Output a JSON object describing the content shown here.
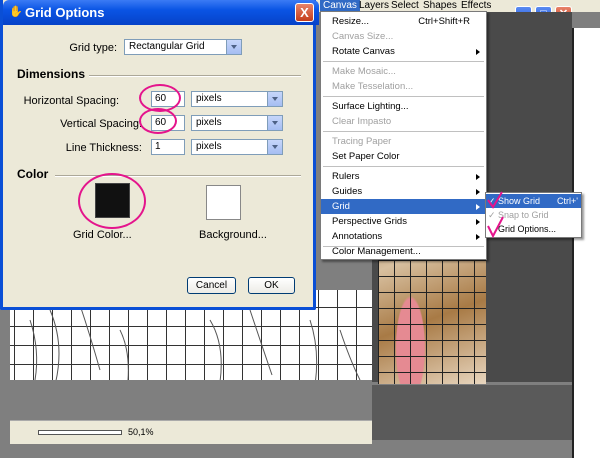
{
  "dialog": {
    "title": "Grid Options",
    "grid_type_label": "Grid type:",
    "grid_type_value": "Rectangular Grid",
    "dimensions_header": "Dimensions",
    "horizontal_spacing_label": "Horizontal Spacing:",
    "horizontal_spacing_value": "60",
    "horizontal_unit": "pixels",
    "vertical_spacing_label": "Vertical Spacing:",
    "vertical_spacing_value": "60",
    "vertical_unit": "pixels",
    "line_thickness_label": "Line Thickness:",
    "line_thickness_value": "1",
    "line_thickness_unit": "pixels",
    "color_header": "Color",
    "grid_color_label": "Grid Color...",
    "background_label": "Background...",
    "cancel_label": "Cancel",
    "ok_label": "OK",
    "close_label": "X",
    "grid_color": "#111111",
    "background_color": "#ffffff"
  },
  "menubar": {
    "items": [
      "Canvas",
      "Layers",
      "Select",
      "Shapes",
      "Effects"
    ],
    "active": "Canvas"
  },
  "canvas_menu": {
    "items": [
      {
        "label": "Resize...",
        "shortcut": "Ctrl+Shift+R"
      },
      {
        "label": "Canvas Size..."
      },
      {
        "label": "Rotate Canvas"
      },
      {
        "label": "Make Mosaic..."
      },
      {
        "label": "Make Tesselation..."
      },
      {
        "label": "Surface Lighting..."
      },
      {
        "label": "Clear Impasto"
      },
      {
        "label": "Tracing Paper"
      },
      {
        "label": "Set Paper Color"
      },
      {
        "label": "Rulers"
      },
      {
        "label": "Guides"
      },
      {
        "label": "Grid"
      },
      {
        "label": "Perspective Grids"
      },
      {
        "label": "Annotations"
      },
      {
        "label": "Color Management..."
      }
    ]
  },
  "grid_submenu": {
    "items": [
      {
        "label": "Show Grid",
        "shortcut": "Ctrl+'"
      },
      {
        "label": "Snap to Grid"
      },
      {
        "label": "Grid Options..."
      }
    ]
  },
  "status": {
    "zoom": "50,1%"
  },
  "colors": {
    "highlight": "#316ac5",
    "annotation": "#e4148c",
    "titlebar": "#0a54e4"
  }
}
